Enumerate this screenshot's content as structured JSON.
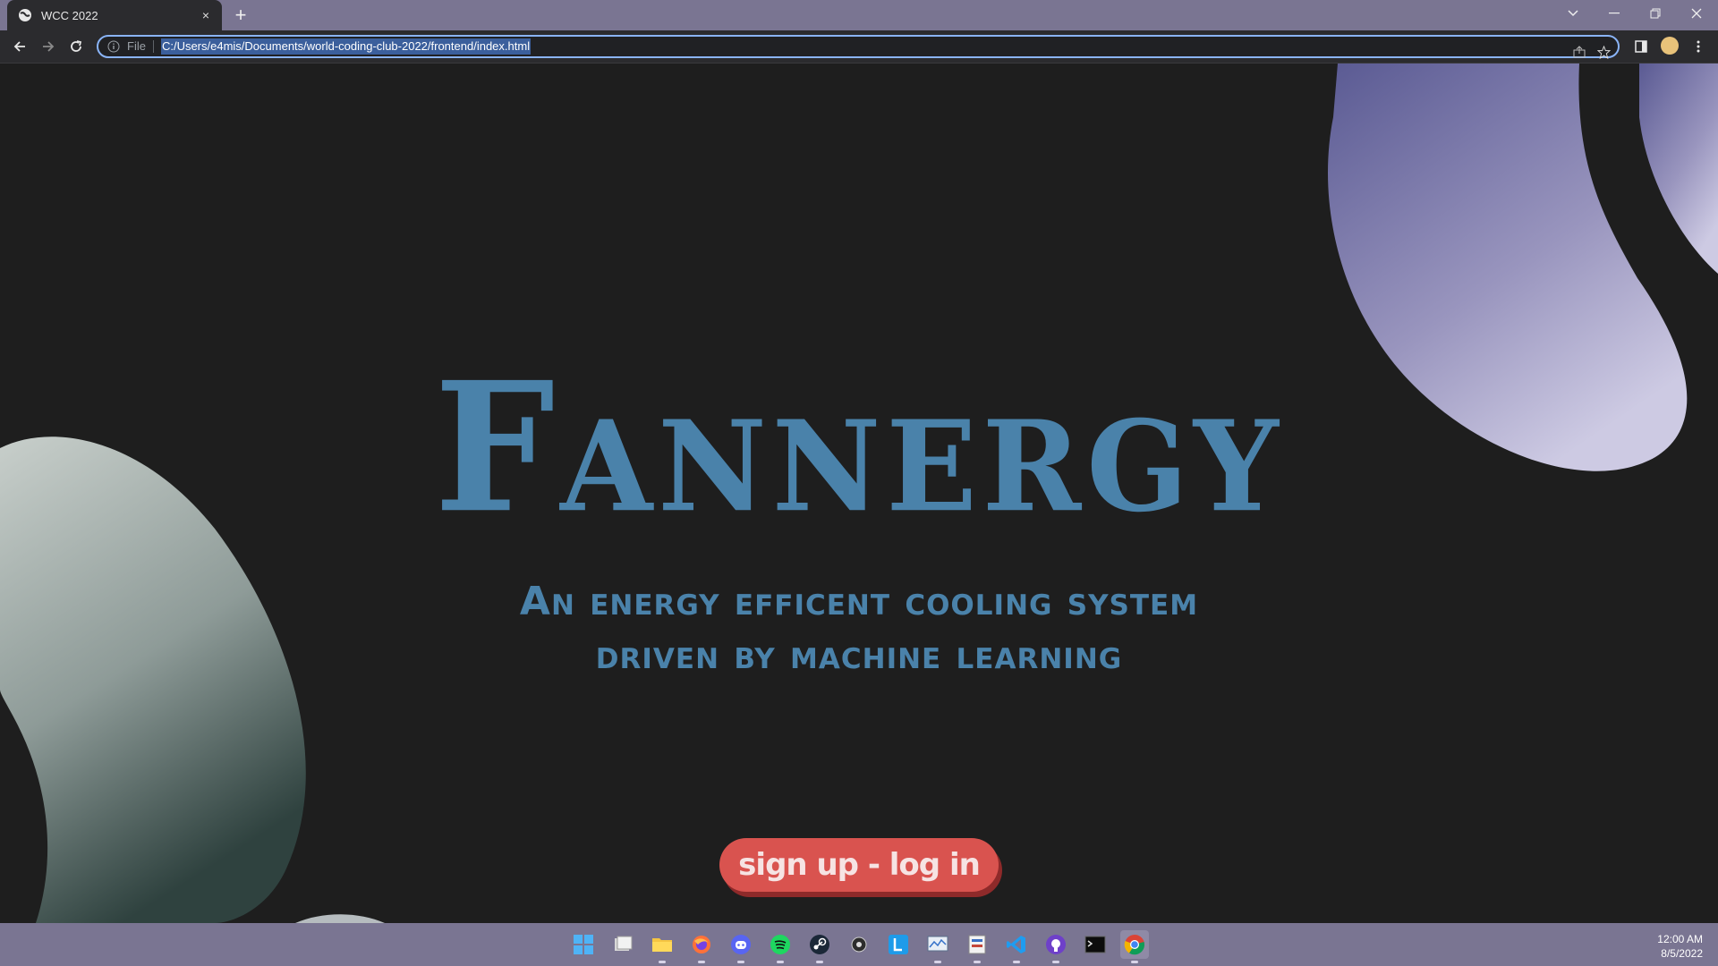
{
  "browser": {
    "tab": {
      "title": "WCC 2022",
      "favicon": "globe-icon",
      "close": "×"
    },
    "new_tab": "+",
    "omnibox": {
      "scheme": "File",
      "url": "C:/Users/e4mis/Documents/world-coding-club-2022/frontend/index.html"
    }
  },
  "page": {
    "brand": "Fannergy",
    "tagline_line1": "An energy efficent cooling system",
    "tagline_line2": "driven by machine learning",
    "cta_label": "sign up - log in",
    "colors": {
      "background": "#1e1e1e",
      "brand": "#4a82aa",
      "cta": "#d9534f",
      "cta_shadow": "#8e2a2a"
    }
  },
  "taskbar": {
    "icons": [
      "windows-start-icon",
      "task-view-icon",
      "file-explorer-icon",
      "firefox-icon",
      "discord-icon",
      "spotify-icon",
      "steam-icon",
      "obs-icon",
      "launcher-l-icon",
      "monitor-app-icon",
      "tool-app-icon",
      "vscode-icon",
      "github-desktop-icon",
      "terminal-icon",
      "chrome-icon"
    ],
    "time": "12:00 AM",
    "date": "8/5/2022"
  }
}
